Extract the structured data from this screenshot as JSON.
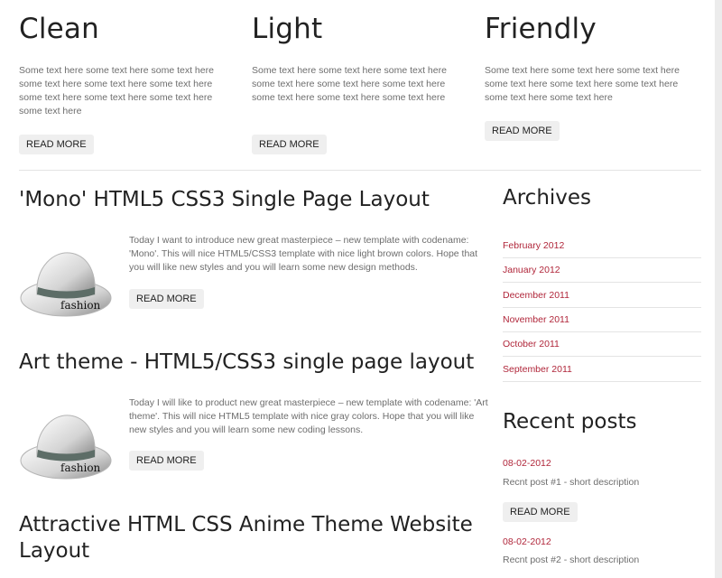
{
  "features": [
    {
      "title": "Clean",
      "text": "Some text here some text here some text here some text here some text here some text here some text here some text here some text here some text here",
      "button": "READ MORE"
    },
    {
      "title": "Light",
      "text": "Some text here some text here some text here some text here some text here some text here some text here some text here some text here",
      "button": "READ MORE"
    },
    {
      "title": "Friendly",
      "text": "Some text here some text here some text here some text here some text here some text here some text here some text here",
      "button": "READ MORE"
    }
  ],
  "posts": [
    {
      "title": "'Mono' HTML5 CSS3 Single Page Layout",
      "text": "Today I want to introduce new great masterpiece – new template with codename: 'Mono'. This will nice HTML5/CSS3 template with nice light brown colors. Hope that you will like new styles and you will learn some new design methods.",
      "button": "READ MORE",
      "thumb_label": "fashion"
    },
    {
      "title": "Art theme - HTML5/CSS3 single page layout",
      "text": "Today I will like to product new great masterpiece – new template with codename: 'Art theme'. This will nice HTML5 template with nice gray colors. Hope that you will like new styles and you will learn some new coding lessons.",
      "button": "READ MORE",
      "thumb_label": "fashion"
    },
    {
      "title": "Attractive HTML CSS Anime Theme Website Layout"
    }
  ],
  "sidebar": {
    "archives_title": "Archives",
    "archives": [
      "February 2012",
      "January 2012",
      "December 2011",
      "November 2011",
      "October 2011",
      "September 2011"
    ],
    "recent_title": "Recent posts",
    "recent": [
      {
        "date": "08-02-2012",
        "desc": "Recnt post #1 - short description",
        "button": "READ MORE"
      },
      {
        "date": "08-02-2012",
        "desc": "Recnt post #2 - short description"
      }
    ]
  },
  "colors": {
    "link": "#b0263a",
    "text": "#6d6d6d",
    "heading": "#222222",
    "button_bg": "#efefef"
  }
}
